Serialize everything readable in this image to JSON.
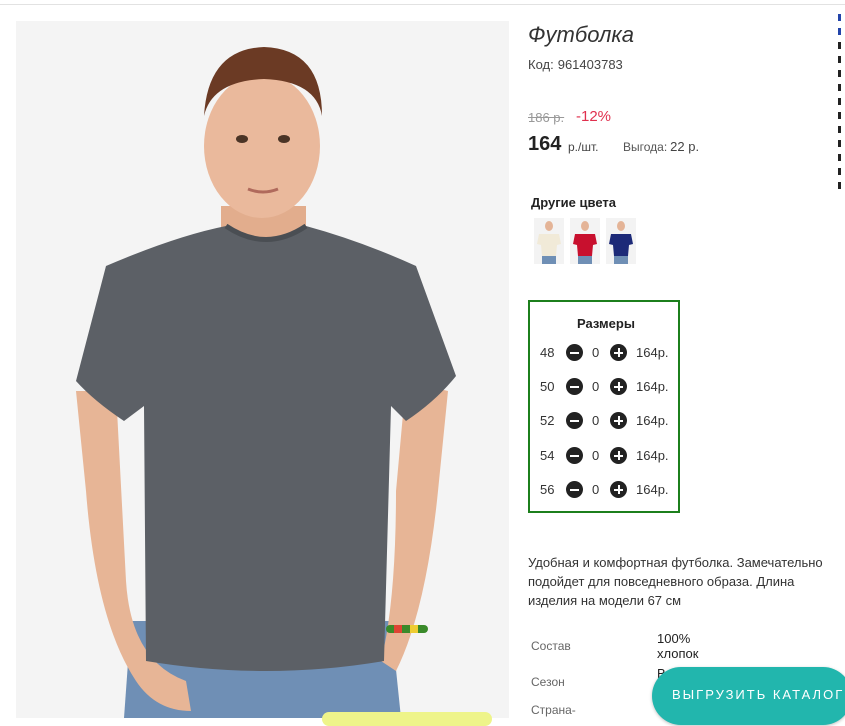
{
  "product": {
    "title": "Футболка",
    "code_label": "Код:",
    "code_value": "961403783",
    "photo_alt": "Футболка"
  },
  "pricing": {
    "old_price": "186 р.",
    "discount": "-12%",
    "price": "164",
    "unit": "р./шт.",
    "benefit_label": "Выгода:",
    "benefit_value": "22 р."
  },
  "other_colors": {
    "title": "Другие цвета",
    "swatches": [
      {
        "name": "cream",
        "color": "#f1ead8"
      },
      {
        "name": "red",
        "color": "#c8102e"
      },
      {
        "name": "navy",
        "color": "#1d2a78"
      }
    ]
  },
  "sizes": {
    "title": "Размеры",
    "rows": [
      {
        "size": "48",
        "qty": "0",
        "price": "164р."
      },
      {
        "size": "50",
        "qty": "0",
        "price": "164р."
      },
      {
        "size": "52",
        "qty": "0",
        "price": "164р."
      },
      {
        "size": "54",
        "qty": "0",
        "price": "164р."
      },
      {
        "size": "56",
        "qty": "0",
        "price": "164р."
      }
    ]
  },
  "description": {
    "lines": [
      "Удобная и комфортная футболка. Замечательно",
      "подойдет для повседневного образа. Длина",
      "изделия на модели 67 см"
    ]
  },
  "specs": {
    "composition_label": "Состав",
    "composition_value_1": "100%",
    "composition_value_2": "хлопок",
    "season_label": "Сезон",
    "season_value": "В",
    "country_label": "Страна-"
  },
  "actions": {
    "export_catalog": "ВЫГРУЗИТЬ КАТАЛОГ"
  },
  "colors": {
    "accent_green": "#1c7f1c",
    "discount_red": "#e0304e",
    "button_teal": "#22b6ad",
    "shirt_gray": "#5c6066"
  }
}
